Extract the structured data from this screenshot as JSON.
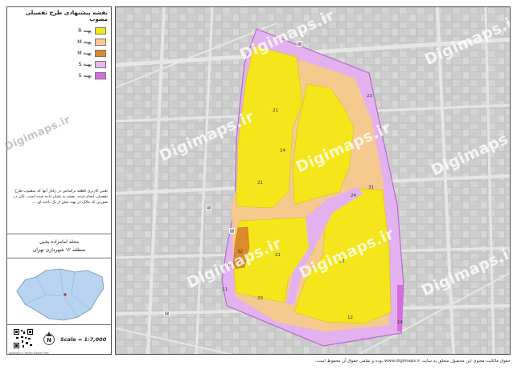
{
  "panel": {
    "title": "نقشه پیشنهادی طرح تفصیلی مصوب",
    "legend": [
      {
        "label": "پهنه R",
        "color": "#f4e61a"
      },
      {
        "label": "پهنه M",
        "color": "#f7c98c"
      },
      {
        "label": "پهنه M",
        "color": "#d98c2b"
      },
      {
        "label": "پهنه S",
        "color": "#e6b8ef"
      },
      {
        "label": "پهنه S",
        "color": "#d66ee0"
      }
    ],
    "description": "تعیین کاربری قطعه براساس در رفتار آنها که بمصوب طرح تفصیلی انجام شده، نقشه به نشان داده شده است. لکن در صورتی که مالک در پهنه بیش از یک ناحیه ای ...",
    "area_name": "محله امامزاده یحیی",
    "district": "منطقه ۱۲ شهرداری تهران",
    "scale": "Scale = 1:7,000",
    "north_label": "N",
    "footer": "Digimaps.ir Tehran Master Plan"
  },
  "map": {
    "zones": [
      {
        "label": "21"
      },
      {
        "label": "14"
      },
      {
        "label": "23"
      },
      {
        "label": "21"
      },
      {
        "label": "21"
      },
      {
        "label": "32"
      },
      {
        "label": "33"
      },
      {
        "label": "21"
      },
      {
        "label": "23"
      },
      {
        "label": "24"
      },
      {
        "label": "31"
      },
      {
        "label": "12"
      },
      {
        "label": "14"
      },
      {
        "label": "11"
      }
    ],
    "watermarks": [
      "Digimaps.ir",
      "Digimaps.ir",
      "Digimaps.ir",
      "Digimaps.ir",
      "Digimaps.ir",
      "Digimaps.ir",
      "Digimaps.ir",
      "Digimaps.ir",
      "Digimaps.ir"
    ],
    "poi_label": "P"
  },
  "credit": "حقوق مالکیت معنوی این محصول متعلق به سایت www.digimaps.ir بوده و تمامی حقوق آن محفوظ است."
}
